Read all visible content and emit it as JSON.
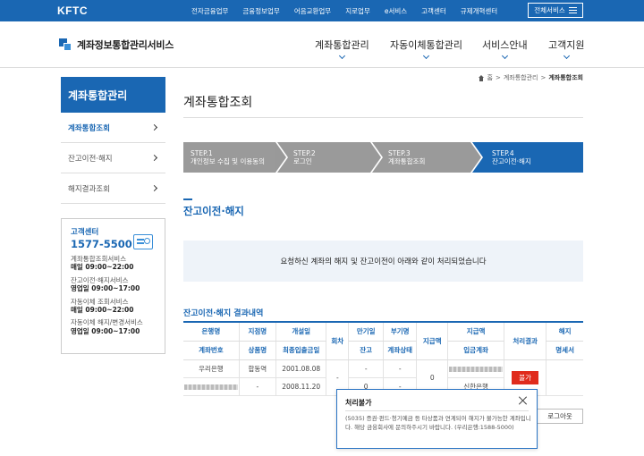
{
  "topbar": {
    "logo": "KFTC",
    "nav": [
      "전자금융업무",
      "금융정보업무",
      "어음교환업무",
      "지로업무",
      "e서비스",
      "고객센터",
      "규제개혁센터"
    ],
    "all_services": "전체서비스"
  },
  "header": {
    "brand": "계좌정보통합관리서비스",
    "nav": [
      "계좌통합관리",
      "자동이체통합관리",
      "서비스안내",
      "고객지원"
    ]
  },
  "breadcrumb": [
    "홈",
    "계좌통합관리",
    "계좌통합조회"
  ],
  "sidebar": {
    "title": "계좌통합관리",
    "items": [
      "계좌통합조회",
      "잔고이전·해지",
      "해지결과조회"
    ],
    "cs": {
      "title": "고객센터",
      "phone": "1577-5500",
      "lines": [
        {
          "t": "계좌통합조회서비스",
          "h": "매일 09:00~22:00"
        },
        {
          "t": "잔고이전·해지서비스",
          "h": "영업일 09:00~17:00"
        },
        {
          "t": "자동이체 조회서비스",
          "h": "매일 09:00~22:00"
        },
        {
          "t": "자동이체 해지/변경서비스",
          "h": "영업일 09:00~17:00"
        }
      ]
    }
  },
  "main": {
    "title": "계좌통합조회",
    "steps": [
      {
        "num": "STEP.1",
        "label": "개인정보 수집 및 이용동의"
      },
      {
        "num": "STEP.2",
        "label": "로그인"
      },
      {
        "num": "STEP.3",
        "label": "계좌통합조회"
      },
      {
        "num": "STEP.4",
        "label": "잔고이전·해지"
      }
    ],
    "section_title": "잔고이전·해지",
    "notice": "요청하신 계좌의 해지 및 잔고이전이 아래와 같이 처리되었습니다",
    "result_title": "잔고이전·해지 결과내역",
    "table": {
      "head1": [
        "은행명",
        "지점명",
        "개설일",
        "회차",
        "만기일",
        "부기명",
        "지급액",
        "지급액",
        "처리결과",
        "해지"
      ],
      "head2": [
        "계좌번호",
        "상품명",
        "최종입출금일",
        "잔고",
        "계좌상태",
        "입금계좌",
        "명세서"
      ],
      "row1": {
        "bank": "우리은행",
        "branch": "합동역",
        "open": "2001.08.08",
        "seq": "-",
        "maturity": "-",
        "memo": "-",
        "amount": "0",
        "dest_bank": "신한은행",
        "result": "불가"
      },
      "row2": {
        "product": "-",
        "last": "2008.11.20",
        "balance": "0",
        "status": "-"
      }
    },
    "logout": "로그아웃"
  },
  "modal": {
    "title": "처리불가",
    "body": "(5035) 증권·펀드·청기예금 등 타상품과 연계되어 해지가 불가능한 계좌입니다. 해당 금융회사에 문의하주시기 바랍니다. (우리은행:1588-5000)"
  },
  "colors": {
    "primary": "#1a67b3",
    "step_grey": "#9a9a9a",
    "fail": "#e02b1c"
  }
}
